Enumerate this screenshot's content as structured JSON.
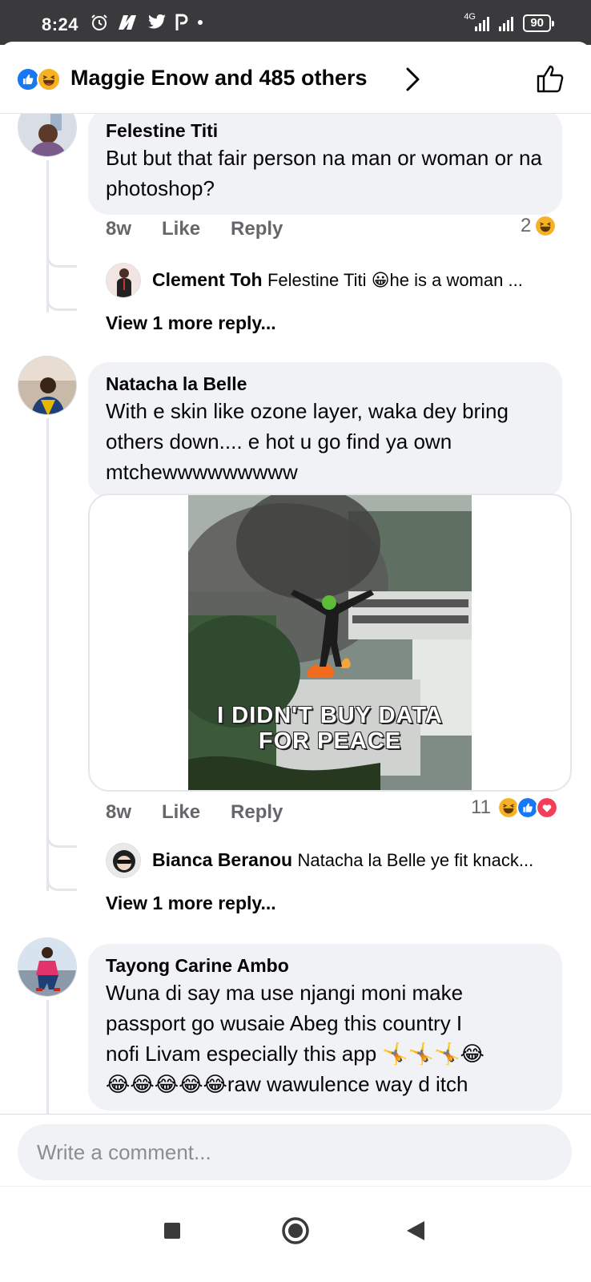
{
  "status_bar": {
    "time": "8:24",
    "network": "4G",
    "battery": "90"
  },
  "header": {
    "title": "Maggie Enow and 485 others"
  },
  "comments": [
    {
      "author": "Felestine Titi",
      "text": "But but that fair person na man or woman or na photoshop?",
      "age": "8w",
      "like_label": "Like",
      "reply_label": "Reply",
      "reaction_count": "2",
      "reply_preview": {
        "author": "Clement Toh",
        "text": "Felestine Titi 😀he is a woman ..."
      },
      "view_more": "View 1 more reply..."
    },
    {
      "author": "Natacha la Belle",
      "text": "With e skin like ozone layer, waka dey bring others down.... e hot u go find ya own  mtchewwwwwwwww",
      "image_caption_line1": "I DIDN'T BUY DATA",
      "image_caption_line2": "FOR PEACE",
      "age": "8w",
      "like_label": "Like",
      "reply_label": "Reply",
      "reaction_count": "11",
      "reply_preview": {
        "author": "Bianca Beranou",
        "text": "Natacha la Belle ye fit knack..."
      },
      "view_more": "View 1 more reply..."
    },
    {
      "author": "Tayong Carine Ambo",
      "text_line1": "Wuna di say ma use njangi moni make",
      "text_line2": "passport go wusaie Abeg this country I",
      "text_line3": "nofi Livam especially this app 🤸🤸🤸😂",
      "text_line4": "😂😂😂😂😂raw wawulence way d itch"
    }
  ],
  "composer": {
    "placeholder": "Write a comment..."
  },
  "colors": {
    "accent": "#1877f2",
    "bubble": "#f0f2f5",
    "meta": "#65676b",
    "haha": "#f7b125",
    "love": "#f33e58"
  }
}
